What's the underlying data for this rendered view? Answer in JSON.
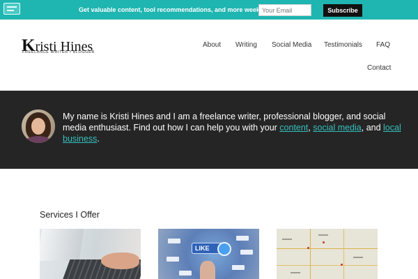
{
  "promo": {
    "text": "Get valuable content, tool recommendations, and more weekly!",
    "email_placeholder": "Your Email",
    "subscribe_label": "Subscribe",
    "bar_color": "#1fb5b1"
  },
  "logo": {
    "first_letter": "K",
    "name_rest": "risti Hines",
    "tagline": "FREELANCE WRITER • BLOGGER"
  },
  "nav": {
    "items": [
      {
        "label": "About"
      },
      {
        "label": "Writing"
      },
      {
        "label": "Social Media"
      },
      {
        "label": "Testimonials"
      },
      {
        "label": "FAQ"
      },
      {
        "label": "Contact"
      }
    ]
  },
  "intro": {
    "text_before": "My name is Kristi Hines and I am a freelance writer, professional blogger, and social media enthusiast. Find out how I can help you with your ",
    "link_content": "content",
    "sep1": ", ",
    "link_social": "social media",
    "sep2": ", and ",
    "link_local": "local business",
    "text_after": ".",
    "background_color": "#252525",
    "link_color": "#35c0bd"
  },
  "services": {
    "heading": "Services I Offer",
    "like_label": "LIKE"
  }
}
